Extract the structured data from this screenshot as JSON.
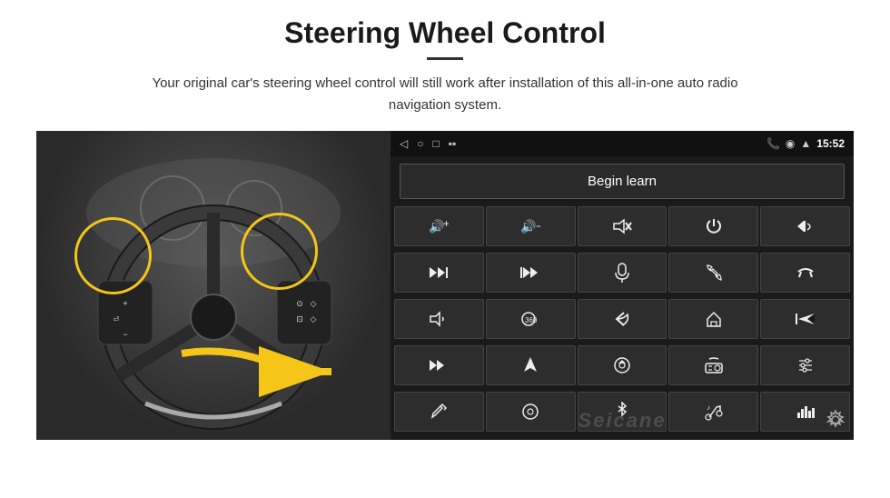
{
  "header": {
    "title": "Steering Wheel Control",
    "subtitle": "Your original car's steering wheel control will still work after installation of this all-in-one auto radio navigation system."
  },
  "status_bar": {
    "time": "15:52",
    "icons": [
      "◁",
      "○",
      "□",
      "▪▪"
    ]
  },
  "begin_learn_button": "Begin learn",
  "controls": [
    {
      "icon": "🔊+",
      "label": "vol-up"
    },
    {
      "icon": "🔊−",
      "label": "vol-down"
    },
    {
      "icon": "🔇",
      "label": "mute"
    },
    {
      "icon": "⏻",
      "label": "power"
    },
    {
      "icon": "⏮",
      "label": "prev-track-phone"
    },
    {
      "icon": "⏭",
      "label": "next-track"
    },
    {
      "icon": "⏩",
      "label": "fast-forward"
    },
    {
      "icon": "🎤",
      "label": "mic"
    },
    {
      "icon": "📞",
      "label": "phone"
    },
    {
      "icon": "↩",
      "label": "hang-up"
    },
    {
      "icon": "📢",
      "label": "speaker"
    },
    {
      "icon": "360°",
      "label": "360-view"
    },
    {
      "icon": "↩",
      "label": "back"
    },
    {
      "icon": "🏠",
      "label": "home"
    },
    {
      "icon": "⏮⏮",
      "label": "skip-back"
    },
    {
      "icon": "⏭⏭",
      "label": "skip-forward"
    },
    {
      "icon": "▶",
      "label": "nav"
    },
    {
      "icon": "⏏",
      "label": "eject"
    },
    {
      "icon": "📻",
      "label": "radio"
    },
    {
      "icon": "⚙",
      "label": "eq"
    },
    {
      "icon": "✏",
      "label": "edit"
    },
    {
      "icon": "⚙",
      "label": "settings-knob"
    },
    {
      "icon": "✱",
      "label": "bluetooth"
    },
    {
      "icon": "♪",
      "label": "music"
    },
    {
      "icon": "▌▌▌",
      "label": "spectrum"
    }
  ],
  "watermark": "Seicane",
  "gear_icon": "⚙"
}
